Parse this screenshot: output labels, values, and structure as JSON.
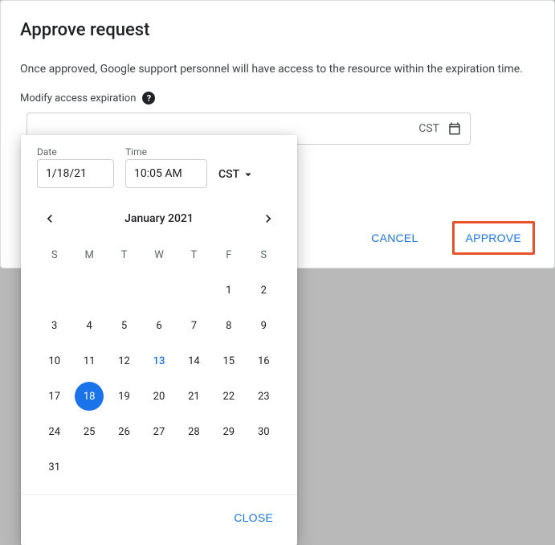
{
  "dialog": {
    "title": "Approve request",
    "description": "Once approved, Google support personnel will have access to the resource within the expiration time.",
    "modify_label": "Modify access expiration",
    "field_tz": "CST",
    "cancel_label": "CANCEL",
    "approve_label": "APPROVE"
  },
  "picker": {
    "date_label": "Date",
    "date_value": "1/18/21",
    "time_label": "Time",
    "time_value": "10:05 AM",
    "tz": "CST",
    "month_label": "January 2021",
    "dow": {
      "0": "S",
      "1": "M",
      "2": "T",
      "3": "W",
      "4": "T",
      "5": "F",
      "6": "S"
    },
    "today": 13,
    "selected": 18,
    "close_label": "CLOSE",
    "grid": [
      [
        "",
        "",
        "",
        "",
        "",
        "1",
        "2"
      ],
      [
        "3",
        "4",
        "5",
        "6",
        "7",
        "8",
        "9"
      ],
      [
        "10",
        "11",
        "12",
        "13",
        "14",
        "15",
        "16"
      ],
      [
        "17",
        "18",
        "19",
        "20",
        "21",
        "22",
        "23"
      ],
      [
        "24",
        "25",
        "26",
        "27",
        "28",
        "29",
        "30"
      ],
      [
        "31",
        "",
        "",
        "",
        "",
        "",
        ""
      ]
    ]
  }
}
